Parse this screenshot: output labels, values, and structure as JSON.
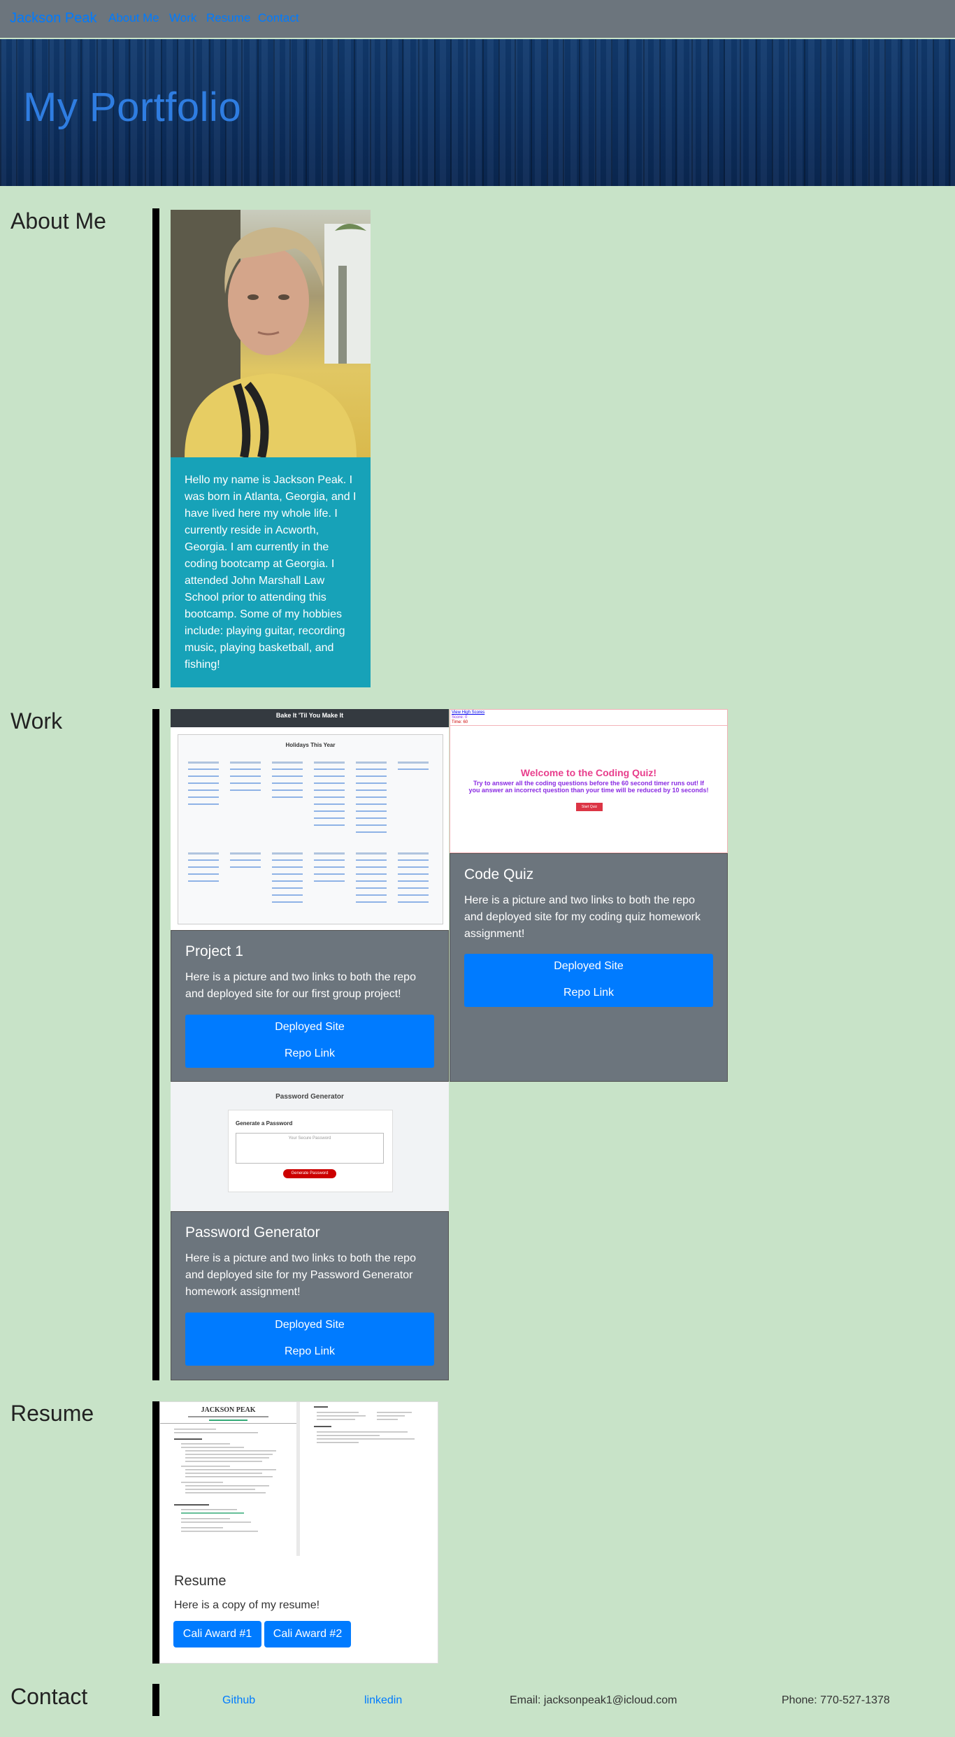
{
  "nav": {
    "brand": "Jackson Peak",
    "links": [
      "About Me",
      "Work",
      "Resume",
      "Contact"
    ]
  },
  "hero": {
    "title": "My Portfolio"
  },
  "about": {
    "heading": "About Me",
    "bio": "Hello my name is Jackson Peak. I was born in Atlanta, Georgia, and I have lived here my whole life. I currently reside in Acworth, Georgia. I am currently in the coding bootcamp at Georgia. I attended John Marshall Law School prior to attending this bootcamp. Some of my hobbies include: playing guitar, recording music, playing basketball, and fishing!"
  },
  "work": {
    "heading": "Work",
    "projects": [
      {
        "title": "Project 1",
        "text": "Here is a picture and two links to both the repo and deployed site for our first group project!",
        "deployed_label": "Deployed Site",
        "repo_label": "Repo Link",
        "shot": {
          "header": "Bake It 'Til You Make It",
          "subheader": "Holidays This Year"
        }
      },
      {
        "title": "Code Quiz",
        "text": "Here is a picture and two links to both the repo and deployed site for my coding quiz homework assignment!",
        "deployed_label": "Deployed Site",
        "repo_label": "Repo Link",
        "shot": {
          "top_link": "View High Scores",
          "score": "Score: 0",
          "time": "Time: 60",
          "heading": "Welcome to the Coding Quiz!",
          "body": "Try to answer all the coding questions before the 60 second timer runs out! If you answer an incorrect question than your time will be reduced by 10 seconds!",
          "button": "Start Quiz"
        }
      },
      {
        "title": "Password Generator",
        "text": "Here is a picture and two links to both the repo and deployed site for my Password Generator homework assignment!",
        "deployed_label": "Deployed Site",
        "repo_label": "Repo Link",
        "shot": {
          "header": "Password Generator",
          "subheader": "Generate a Password",
          "placeholder": "Your Secure Password",
          "button": "Generate Password"
        }
      }
    ]
  },
  "resume": {
    "heading": "Resume",
    "card_title": "Resume",
    "card_text": "Here is a copy of my resume!",
    "buttons": [
      "Cali Award #1",
      "Cali Award #2"
    ],
    "doc_name": "JACKSON PEAK"
  },
  "contact": {
    "heading": "Contact",
    "github": "Github",
    "linkedin": "linkedin",
    "email": "Email: jacksonpeak1@icloud.com",
    "phone": "Phone: 770-527-1378"
  },
  "colors": {
    "page_bg": "#c8e3c8",
    "navbar_bg": "#6c757d",
    "link": "#007bff",
    "about_card": "#17a2b8",
    "work_card": "#6c757d",
    "primary_button": "#007bff"
  }
}
